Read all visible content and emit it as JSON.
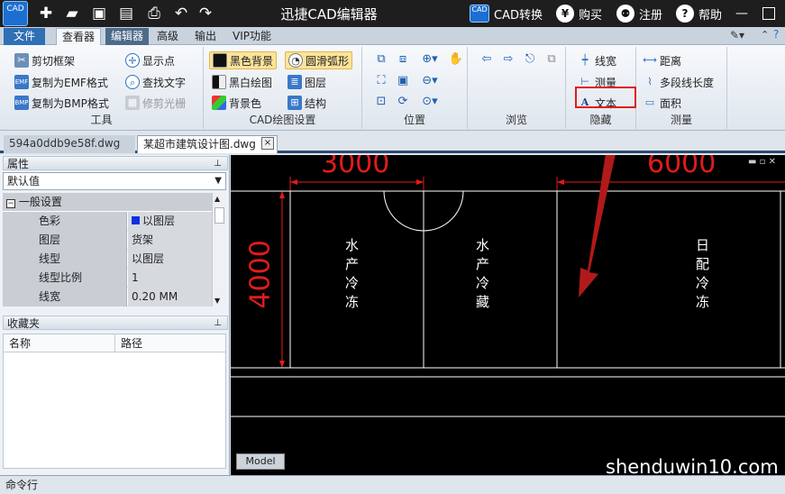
{
  "window": {
    "title": "迅捷CAD编辑器",
    "logo_text": "CAD",
    "cad_convert": "CAD转换",
    "cad_badge": "CAD",
    "buy": "购买",
    "buy_symbol": "¥",
    "register": "注册",
    "help": "帮助",
    "help_symbol": "?"
  },
  "menu": {
    "file": "文件",
    "tabs": [
      "查看器",
      "编辑器",
      "高级",
      "输出",
      "VIP功能"
    ]
  },
  "ribbon": {
    "tools": {
      "label": "工具",
      "items": [
        "剪切框架",
        "复制为EMF格式",
        "复制为BMP格式",
        "显示点",
        "查找文字",
        "修剪光栅"
      ]
    },
    "cad_settings": {
      "label": "CAD绘图设置",
      "items": [
        "黑色背景",
        "黑白绘图",
        "背景色",
        "圆滑弧形",
        "图层",
        "结构"
      ]
    },
    "position": {
      "label": "位置"
    },
    "browse": {
      "label": "浏览"
    },
    "hide": {
      "label": "隐藏",
      "items": [
        "线宽",
        "测量",
        "文本"
      ]
    },
    "measure": {
      "label": "测量",
      "items": [
        "距离",
        "多段线长度",
        "面积"
      ]
    }
  },
  "doc_tabs": [
    "594a0ddb9e58f.dwg",
    "某超市建筑设计图.dwg"
  ],
  "doc_close": "×",
  "properties": {
    "title": "属性",
    "combo": "默认值",
    "group": "一般设置",
    "rows": [
      {
        "name": "色彩",
        "value": "以图层"
      },
      {
        "name": "图层",
        "value": "货架"
      },
      {
        "name": "线型",
        "value": "以图层"
      },
      {
        "name": "线型比例",
        "value": "1"
      },
      {
        "name": "线宽",
        "value": "0.20 MM"
      }
    ]
  },
  "favorites": {
    "title": "收藏夹",
    "col_name": "名称",
    "col_path": "路径"
  },
  "drawing": {
    "dim_top_left": "3000",
    "dim_top_right": "6000",
    "dim_left": "4000",
    "room1": [
      "水",
      "产",
      "冷",
      "冻"
    ],
    "room2": [
      "水",
      "产",
      "冷",
      "藏"
    ],
    "room3": [
      "日",
      "配",
      "冷",
      "冻"
    ],
    "model_tab": "Model",
    "watermark": "shenduwin10.com"
  },
  "command_bar": "命令行",
  "colors": {
    "dimension_red": "#e21b1b",
    "accent_blue": "#2f6fb6"
  }
}
